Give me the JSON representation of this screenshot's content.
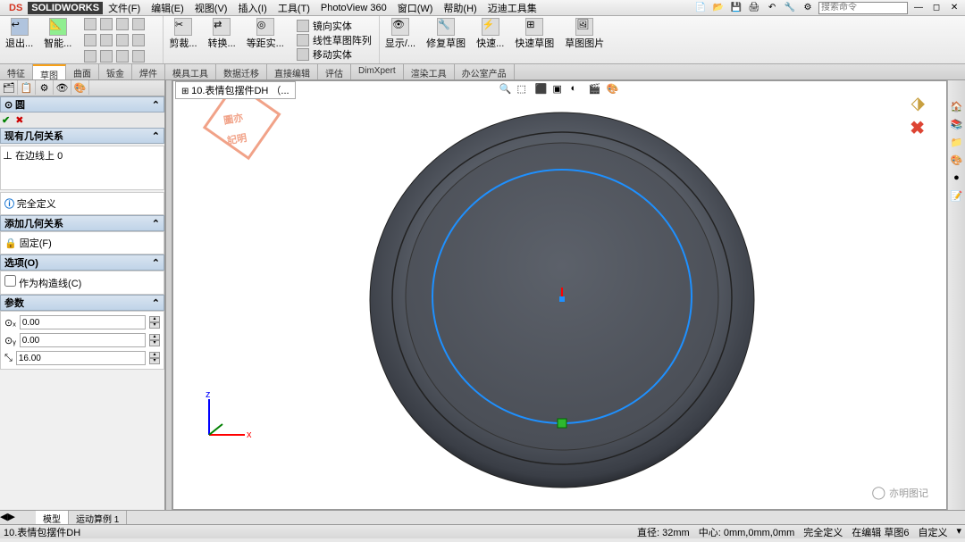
{
  "title": {
    "logo": "DS",
    "brand": "SOLIDWORKS"
  },
  "menu": [
    "文件(F)",
    "编辑(E)",
    "视图(V)",
    "插入(I)",
    "工具(T)",
    "PhotoView 360",
    "窗口(W)",
    "帮助(H)",
    "迈迪工具集"
  ],
  "search_placeholder": "搜索命令",
  "ribbon": {
    "exit": "退出...",
    "smart": "智能...",
    "trim": "剪裁...",
    "convert": "转换...",
    "offset": "等距实...",
    "mirror": "镜向实体",
    "linear": "线性草图阵列",
    "move": "移动实体",
    "display": "显示/...",
    "repair": "修复草图",
    "quick": "快速...",
    "snap": "快速草图",
    "pic": "草图图片"
  },
  "tabs": [
    "特征",
    "草图",
    "曲面",
    "钣金",
    "焊件",
    "模具工具",
    "数据迁移",
    "直接编辑",
    "评估",
    "DimXpert",
    "渲染工具",
    "办公室产品"
  ],
  "active_tab": "草图",
  "doc_name": "10.表情包摆件DH （...",
  "left": {
    "title": "圆",
    "rel_hdr": "现有几何关系",
    "rel_item": "在边线上 0",
    "status": "完全定义",
    "add_hdr": "添加几何关系",
    "fixed": "固定(F)",
    "opt_hdr": "选项(O)",
    "construction": "作为构造线(C)",
    "param_hdr": "参数",
    "cx": "0.00",
    "cy": "0.00",
    "radius": "16.00"
  },
  "bottom_tabs": [
    "模型",
    "运动算例 1"
  ],
  "status": {
    "file": "10.表情包摆件DH",
    "diameter": "直径: 32mm",
    "center": "中心: 0mm,0mm,0mm",
    "def": "完全定义",
    "editing": "在编辑 草图6",
    "custom": "自定义"
  },
  "watermark": "亦明图记"
}
